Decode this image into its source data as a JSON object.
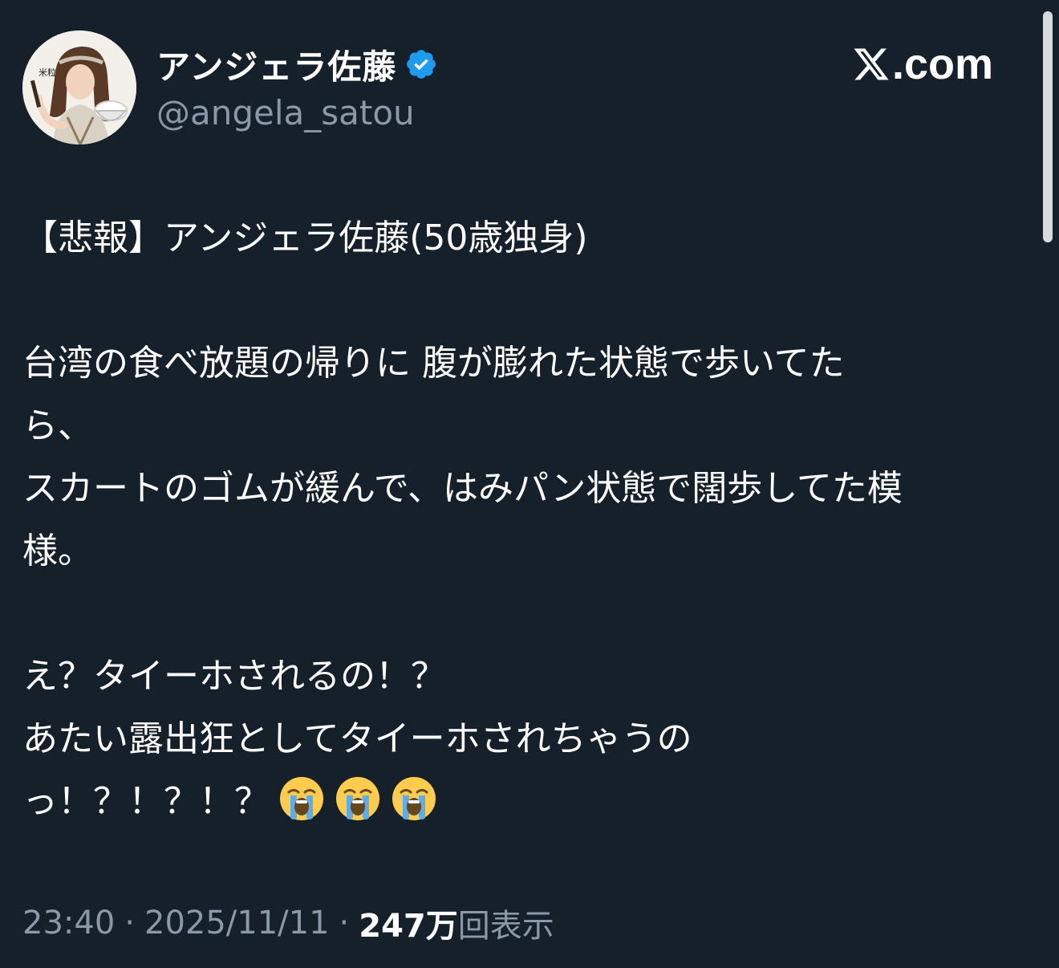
{
  "post": {
    "author": {
      "display_name": "アンジェラ佐藤",
      "handle": "@angela_satou",
      "verified": true,
      "avatar_badge_text": "米粒"
    },
    "brand": {
      "icon": "x-logo-icon",
      "domain": ".com"
    },
    "body": {
      "lines": [
        "【悲報】アンジェラ佐藤(50歳独身)",
        "",
        "台湾の食べ放題の帰りに 腹が膨れた状態で歩いてた",
        "ら、",
        "スカートのゴムが緩んで、はみパン状態で闊歩してた模",
        "様。",
        "",
        "え？タイーホされるの！？",
        "あたい露出狂としてタイーホされちゃうの",
        "っ！？！？！？"
      ],
      "emoji": [
        "loudly-crying-face-icon",
        "loudly-crying-face-icon",
        "loudly-crying-face-icon"
      ]
    },
    "meta": {
      "time": "23:40",
      "separator": "·",
      "date": "2025/11/11",
      "views_count": "247万",
      "views_label": "回表示"
    }
  },
  "colors": {
    "background": "#15202b",
    "text_primary": "#ffffff",
    "text_secondary": "#8b98a5",
    "verified_badge": "#1d9bf0",
    "scrollbar": "#e8ebee"
  }
}
